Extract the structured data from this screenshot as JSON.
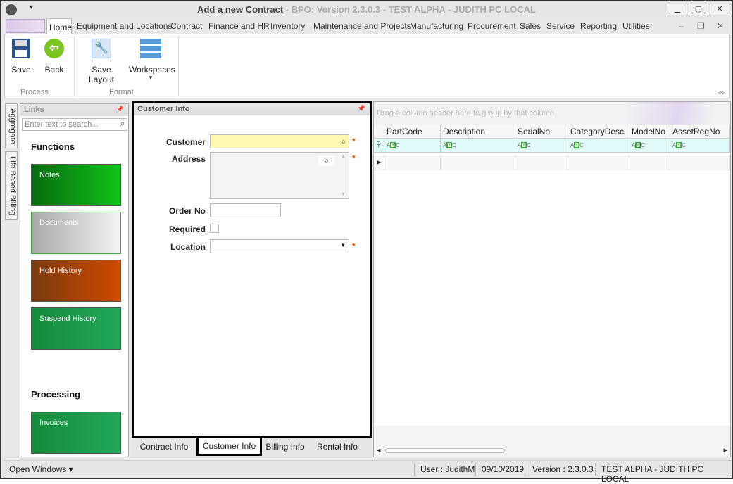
{
  "window": {
    "title": "Add a new Contract",
    "subtitle": " - BPO: Version 2.3.0.3 - TEST ALPHA - JUDITH PC LOCAL",
    "minimize": "▁",
    "maximize": "▢",
    "close": "✕"
  },
  "menu": {
    "tabs": [
      "Home",
      "Equipment and Locations",
      "Contract",
      "Finance and HR",
      "Inventory",
      "Maintenance and Projects",
      "Manufacturing",
      "Procurement",
      "Sales",
      "Service",
      "Reporting",
      "Utilities"
    ]
  },
  "ribbon": {
    "save": "Save",
    "back": "Back",
    "save_layout": "Save Layout",
    "workspaces": "Workspaces",
    "group_process": "Process",
    "group_format": "Format"
  },
  "side_tabs": [
    "Aggregate",
    "Life Based Billing"
  ],
  "links": {
    "title": "Links",
    "search_placeholder": "Enter text to search...",
    "functions_heading": "Functions",
    "processing_heading": "Processing",
    "tiles": [
      {
        "label": "Notes"
      },
      {
        "label": "Documents"
      },
      {
        "label": "Hold History"
      },
      {
        "label": "Suspend History"
      },
      {
        "label": "Invoices"
      }
    ]
  },
  "customer_info": {
    "title": "Customer Info",
    "customer_label": "Customer",
    "address_label": "Address",
    "order_no_label": "Order No",
    "required_label": "Required",
    "location_label": "Location",
    "required_mark": "*",
    "customer_value": "",
    "order_no_value": "",
    "location_value": "",
    "required_checked": false
  },
  "bottom_tabs": [
    "Contract Info",
    "Customer Info",
    "Billing Info",
    "Rental Info"
  ],
  "active_bottom_tab": "Customer Info",
  "grid": {
    "group_hint": "Drag a column header here to group by that column",
    "columns": [
      "PartCode",
      "Description",
      "SerialNo",
      "CategoryDesc",
      "ModelNo",
      "AssetRegNo"
    ],
    "filter_text": "ABC"
  },
  "status": {
    "open_windows": "Open Windows ▾",
    "user": "User : JudithM",
    "date": "09/10/2019",
    "version": "Version : 2.3.0.3",
    "env": "TEST ALPHA - JUDITH PC LOCAL"
  },
  "colors": {
    "notes": "#0a9a1a",
    "documents": "#c8c8c8",
    "hold_history": "#b84a10",
    "suspend_history": "#1f9e55",
    "invoices": "#1f9e55",
    "required": "#e05000"
  }
}
